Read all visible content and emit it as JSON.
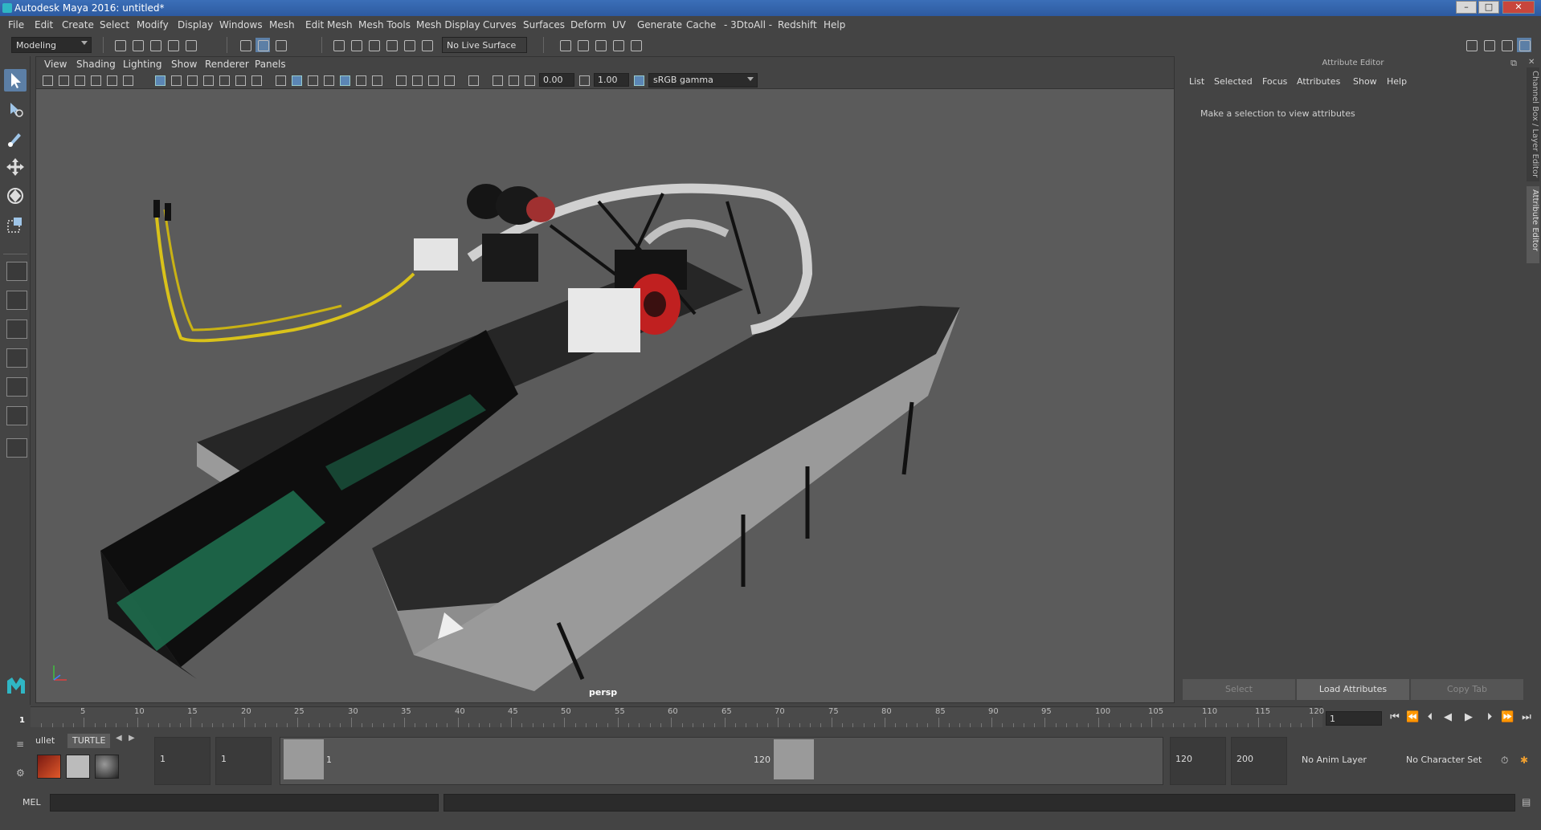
{
  "window": {
    "title": "Autodesk Maya 2016: untitled*",
    "minimize": "–",
    "maximize": "□",
    "close": "✕"
  },
  "menubar": [
    "File",
    "Edit",
    "Create",
    "Select",
    "Modify",
    "Display",
    "Windows",
    "Mesh",
    "Edit Mesh",
    "Mesh Tools",
    "Mesh Display",
    "Curves",
    "Surfaces",
    "Deform",
    "UV",
    "Generate",
    "Cache",
    "- 3DtoAll -",
    "Redshift",
    "Help"
  ],
  "statusline": {
    "mode": "Modeling",
    "live_surface": "No Live Surface"
  },
  "viewport": {
    "menu": [
      "View",
      "Shading",
      "Lighting",
      "Show",
      "Renderer",
      "Panels"
    ],
    "exposure": "0.00",
    "gamma": "1.00",
    "color_space": "sRGB gamma",
    "camera": "persp"
  },
  "attribute_editor": {
    "header": "Attribute Editor",
    "menu": [
      "List",
      "Selected",
      "Focus",
      "Attributes",
      "Show",
      "Help"
    ],
    "message": "Make a selection to view attributes",
    "buttons": [
      "Select",
      "Load Attributes",
      "Copy Tab"
    ],
    "side_tabs": [
      "Channel Box / Layer Editor",
      "Attribute Editor"
    ]
  },
  "timeline": {
    "ticks": [
      "5",
      "10",
      "15",
      "20",
      "25",
      "30",
      "35",
      "40",
      "45",
      "50",
      "55",
      "60",
      "65",
      "70",
      "75",
      "80",
      "85",
      "90",
      "95",
      "100",
      "105",
      "110",
      "115",
      "120"
    ],
    "current_marker": "1",
    "current_frame": "1"
  },
  "range": {
    "shelf_tabs": [
      "ullet",
      "TURTLE"
    ],
    "start": "1",
    "playback_start": "1",
    "range_start_label": "1",
    "range_end_label": "120",
    "playback_end": "120",
    "end": "200",
    "anim_layer": "No Anim Layer",
    "character_set": "No Character Set"
  },
  "cmdline": {
    "label": "MEL"
  },
  "colors": {
    "accent": "#5c7fa6",
    "titlebar": "#2d5aa0",
    "viewport_bg": "#5b5b5b"
  }
}
